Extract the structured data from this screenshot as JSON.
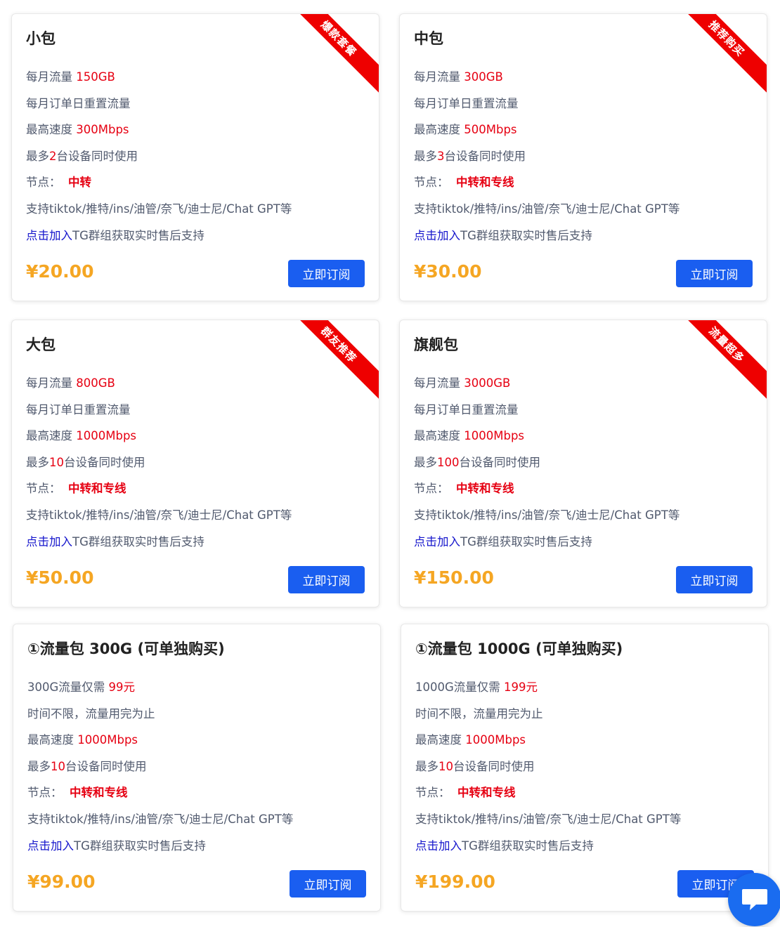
{
  "cards": [
    {
      "title": "小包",
      "ribbon": "爆款套餐",
      "f1": {
        "label": "每月流量 ",
        "value": "150GB"
      },
      "f2": "每月订单日重置流量",
      "f3": {
        "label": "最高速度 ",
        "value": "300Mbps"
      },
      "f4": {
        "prefix": "最多",
        "count": "2",
        "suffix": "台设备同时使用"
      },
      "f5": {
        "label": "节点：",
        "value": "中转"
      },
      "f6": "支持tiktok/推特/ins/油管/奈飞/迪士尼/Chat GPT等",
      "f7": {
        "link": "点击加入",
        "text": "TG群组获取实时售后支持"
      },
      "price": "¥20.00",
      "button": "立即订阅"
    },
    {
      "title": "中包",
      "ribbon": "推荐购买",
      "f1": {
        "label": "每月流量 ",
        "value": "300GB"
      },
      "f2": "每月订单日重置流量",
      "f3": {
        "label": "最高速度 ",
        "value": "500Mbps"
      },
      "f4": {
        "prefix": "最多",
        "count": "3",
        "suffix": "台设备同时使用"
      },
      "f5": {
        "label": "节点：",
        "value": "中转和专线"
      },
      "f6": "支持tiktok/推特/ins/油管/奈飞/迪士尼/Chat GPT等",
      "f7": {
        "link": "点击加入",
        "text": "TG群组获取实时售后支持"
      },
      "price": "¥30.00",
      "button": "立即订阅"
    },
    {
      "title": "大包",
      "ribbon": "群友推荐",
      "f1": {
        "label": "每月流量 ",
        "value": "800GB"
      },
      "f2": "每月订单日重置流量",
      "f3": {
        "label": "最高速度 ",
        "value": "1000Mbps"
      },
      "f4": {
        "prefix": "最多",
        "count": "10",
        "suffix": "台设备同时使用"
      },
      "f5": {
        "label": "节点：",
        "value": "中转和专线"
      },
      "f6": "支持tiktok/推特/ins/油管/奈飞/迪士尼/Chat GPT等",
      "f7": {
        "link": "点击加入",
        "text": "TG群组获取实时售后支持"
      },
      "price": "¥50.00",
      "button": "立即订阅"
    },
    {
      "title": "旗舰包",
      "ribbon": "流量超多",
      "f1": {
        "label": "每月流量 ",
        "value": "3000GB"
      },
      "f2": "每月订单日重置流量",
      "f3": {
        "label": "最高速度 ",
        "value": "1000Mbps"
      },
      "f4": {
        "prefix": "最多",
        "count": "100",
        "suffix": "台设备同时使用"
      },
      "f5": {
        "label": "节点：",
        "value": "中转和专线"
      },
      "f6": "支持tiktok/推特/ins/油管/奈飞/迪士尼/Chat GPT等",
      "f7": {
        "link": "点击加入",
        "text": "TG群组获取实时售后支持"
      },
      "price": "¥150.00",
      "button": "立即订阅"
    },
    {
      "title": "①流量包 300G (可单独购买)",
      "f1": {
        "label": "300G流量仅需 ",
        "value": "99元"
      },
      "f2": "时间不限，流量用完为止",
      "f3": {
        "label": "最高速度 ",
        "value": "1000Mbps"
      },
      "f4": {
        "prefix": "最多",
        "count": "10",
        "suffix": "台设备同时使用"
      },
      "f5": {
        "label": "节点：",
        "value": "中转和专线"
      },
      "f6": "支持tiktok/推特/ins/油管/奈飞/迪士尼/Chat GPT等",
      "f7": {
        "link": "点击加入",
        "text": "TG群组获取实时售后支持"
      },
      "price": "¥99.00",
      "button": "立即订阅"
    },
    {
      "title": "①流量包 1000G (可单独购买)",
      "f1": {
        "label": "1000G流量仅需 ",
        "value": "199元"
      },
      "f2": "时间不限，流量用完为止",
      "f3": {
        "label": "最高速度 ",
        "value": "1000Mbps"
      },
      "f4": {
        "prefix": "最多",
        "count": "10",
        "suffix": "台设备同时使用"
      },
      "f5": {
        "label": "节点：",
        "value": "中转和专线"
      },
      "f6": "支持tiktok/推特/ins/油管/奈飞/迪士尼/Chat GPT等",
      "f7": {
        "link": "点击加入",
        "text": "TG群组获取实时售后支持"
      },
      "price": "¥199.00",
      "button": "立即订阅"
    }
  ],
  "colors": {
    "accent": "#1a5ef0",
    "highlight": "#e60012",
    "price": "#f5a623",
    "ribbon": "#ee0000",
    "link": "#1515cc"
  },
  "chat_icon": "chat-bubble-icon"
}
